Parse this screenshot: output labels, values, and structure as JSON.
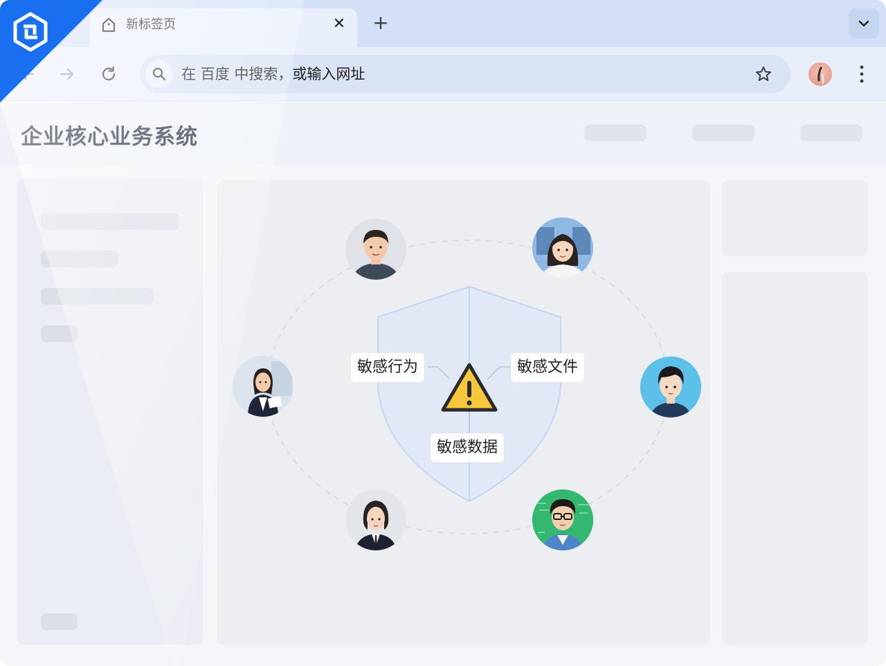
{
  "browser": {
    "tab": {
      "title": "新标签页"
    },
    "new_tab_label": "+",
    "address_bar": {
      "placeholder": "在 百度 中搜索，或输入网址"
    }
  },
  "app": {
    "title": "企业核心业务系统"
  },
  "diagram": {
    "labels": {
      "behavior": "敏感行为",
      "files": "敏感文件",
      "data": "敏感数据"
    },
    "center_icon": "warning-icon",
    "shield_icon": "shield-icon",
    "people_count": 6
  },
  "colors": {
    "accent": "#1a73e8",
    "warning": "#f8c73c",
    "tabstrip": "#d3e0f7",
    "toolbar": "#e9effa"
  }
}
